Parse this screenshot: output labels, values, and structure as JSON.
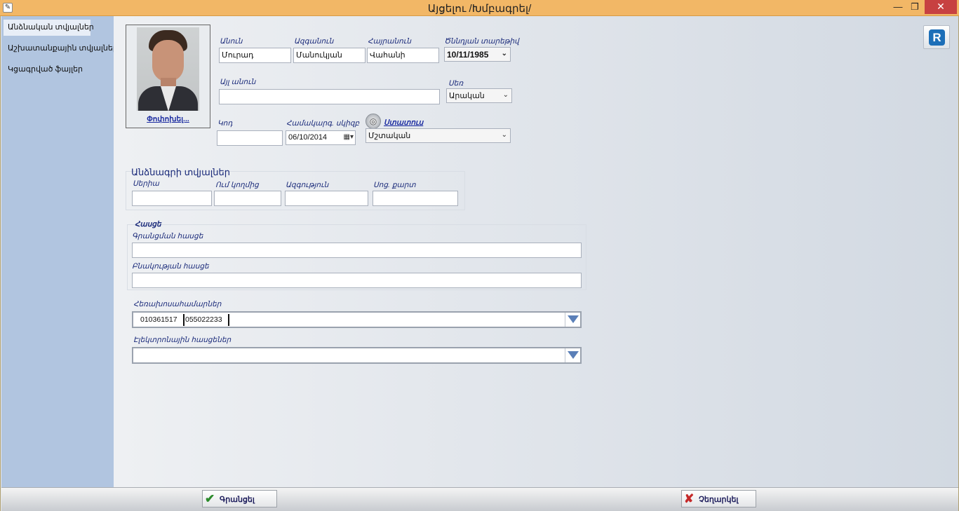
{
  "window": {
    "title": "Այցելու  /Խմբագրել/",
    "minimize_glyph": "—",
    "maximize_glyph": "❐",
    "close_glyph": "✕"
  },
  "sidebar": {
    "items": [
      {
        "label": "Անձնական տվյալներ",
        "active": true
      },
      {
        "label": "Աշխատանքային տվյալներ",
        "active": false
      },
      {
        "label": "Կցագրված ֆայլեր",
        "active": false
      }
    ]
  },
  "photo": {
    "change_link": "Փոփոխել..."
  },
  "personal": {
    "first_name_label": "Անուն",
    "first_name_value": "Մուրադ",
    "last_name_label": "Ազգանուն",
    "last_name_value": "Մանուկյան",
    "patronymic_label": "Հայրանուն",
    "patronymic_value": "Վահանի",
    "birth_date_label": "Ծննդյան տարեթիվ",
    "birth_date_value": "10/11/1985",
    "other_name_label": "Այլ անուն",
    "other_name_value": "",
    "gender_label": "Սեռ",
    "gender_value": "Արական",
    "code_label": "Կոդ",
    "code_value": "",
    "entry_date_label": "Համակարգ. սկիզբ",
    "entry_date_value": "06/10/2014",
    "status_link": "Ստատուս",
    "status_value": "Մշտական"
  },
  "passport": {
    "title": "Անձնագրի տվյալներ",
    "series_label": "Սերիա",
    "series_value": "",
    "issued_by_label": "Ում կողմից",
    "issued_by_value": "",
    "nationality_label": "Ազգություն",
    "nationality_value": "",
    "social_card_label": "Սոց. քարտ",
    "social_card_value": ""
  },
  "address": {
    "title": "Հասցե",
    "registration_label": "Գրանցման հասցե",
    "registration_value": "",
    "residence_label": "Բնակության հասցե",
    "residence_value": ""
  },
  "contacts": {
    "phones_label": "Հեռախոսահամարներ",
    "phones": [
      "010361517",
      "055022233"
    ],
    "emails_label": "Էլեկտրոնային հասցեներ",
    "emails_value": ""
  },
  "footer": {
    "save_label": "Գրանցել",
    "cancel_label": "Չեղարկել"
  },
  "colors": {
    "titlebar": "#f2b766",
    "sidebar": "#b1c5e0",
    "close_button": "#c74141",
    "dropdown_arrow": "#5a7fb8"
  }
}
